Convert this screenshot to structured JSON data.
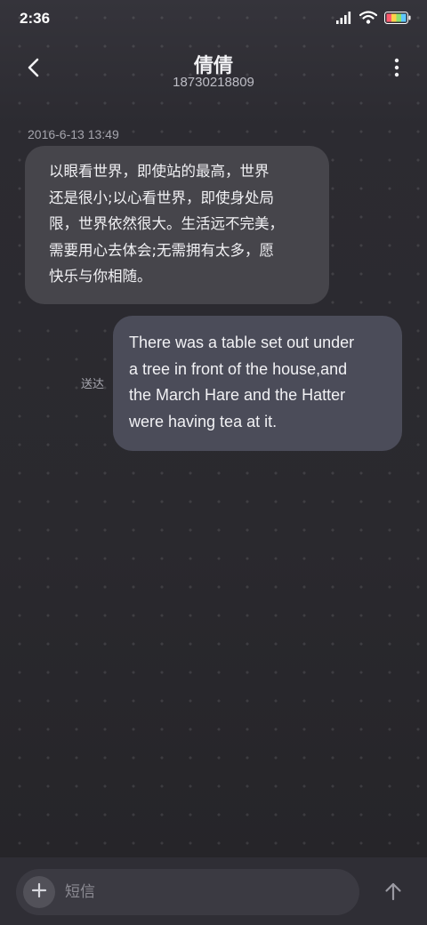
{
  "status_bar": {
    "time": "2:36",
    "icons": [
      "signal-icon",
      "wifi-icon",
      "battery-icon"
    ]
  },
  "header": {
    "contact_name": "倩倩",
    "contact_number": "18730218809",
    "back_icon": "chevron-left-icon",
    "more_icon": "more-vertical-icon"
  },
  "messages": {
    "timestamp": "2016-6-13 13:49",
    "incoming_text": "以眼看世界，即使站的最高，世界\n还是很小;以心看世界，即使身处局\n限，世界依然很大。生活远不完美，\n需要用心去体会;无需拥有太多，愿\n快乐与你相随。",
    "outgoing_text": "There was a table set out under\na tree in front of the house,and\nthe March Hare and the Hatter\nwere having tea at it.",
    "outgoing_status": "送达"
  },
  "composer": {
    "placeholder": "短信",
    "value": "",
    "add_icon": "plus-icon",
    "send_icon": "arrow-up-icon"
  },
  "colors": {
    "background": "#2a292e",
    "incoming_bubble": "#46454b",
    "outgoing_bubble": "#4b4c59",
    "input_bar": "#2f2e35"
  }
}
